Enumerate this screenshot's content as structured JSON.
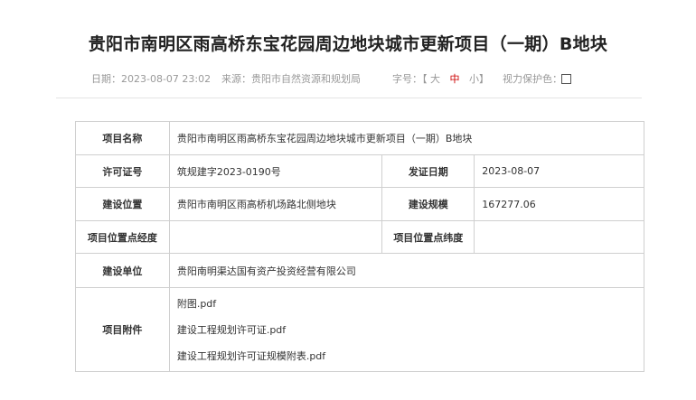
{
  "title": "贵阳市南明区雨高桥东宝花园周边地块城市更新项目（一期）B地块",
  "meta": {
    "date_label": "日期：2023-08-07 23:02",
    "source_label": "来源：贵阳市自然资源和规划局",
    "font_size_label": "字号：",
    "font_size_open": "【",
    "font_large": "大",
    "font_medium": "中",
    "font_small": "小",
    "font_size_close": "】",
    "eye_protect_label": "视力保护色：",
    "swatch_colors": [
      "#ffffcc",
      "#e6f5e6",
      "#e0e8f5",
      "#f5e6f5",
      "#d8d8f0",
      "#ffffff"
    ]
  },
  "table": {
    "project_name_label": "项目名称",
    "project_name_value": "贵阳市南明区雨高桥东宝花园周边地块城市更新项目（一期）B地块",
    "permit_no_label": "许可证号",
    "permit_no_value": "筑规建字2023-0190号",
    "issue_date_label": "发证日期",
    "issue_date_value": "2023-08-07",
    "location_label": "建设位置",
    "location_value": "贵阳市南明区雨高桥机场路北侧地块",
    "scale_label": "建设规模",
    "scale_value": "167277.06",
    "longitude_label": "项目位置点经度",
    "longitude_value": "",
    "latitude_label": "项目位置点纬度",
    "latitude_value": "",
    "unit_label": "建设单位",
    "unit_value": "贵阳南明渠达国有资产投资经营有限公司",
    "attachments_label": "项目附件",
    "attachments": [
      "附图.pdf",
      "建设工程规划许可证.pdf",
      "建设工程规划许可证规模附表.pdf"
    ]
  }
}
